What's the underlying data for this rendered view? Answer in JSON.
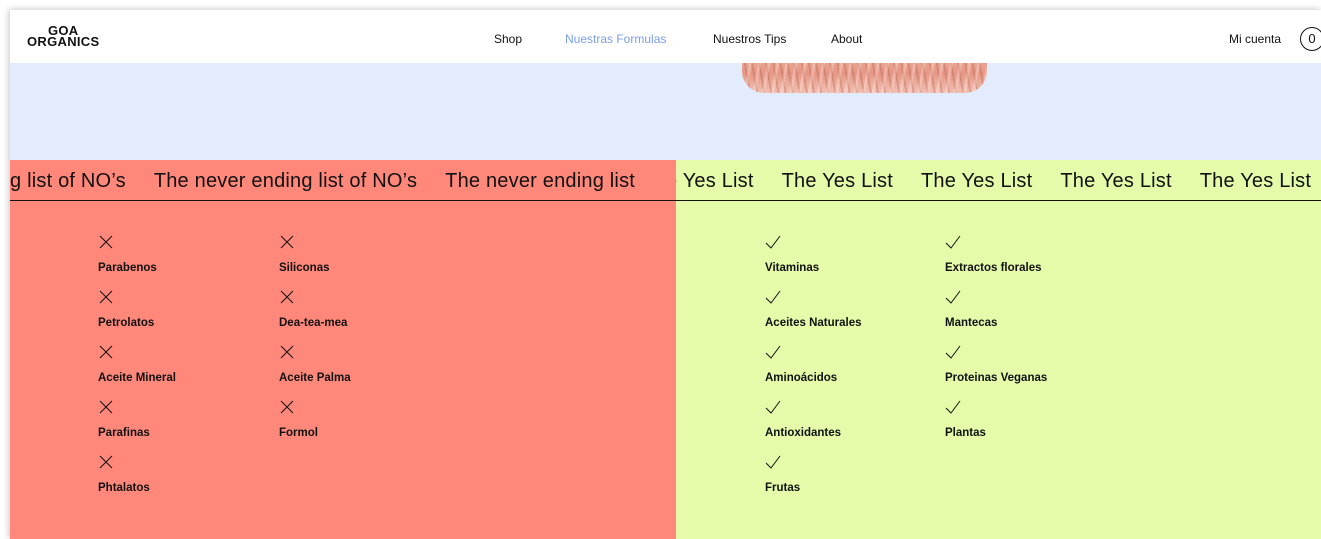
{
  "brand": {
    "logo_line1": "GOA",
    "logo_line2": "ORGANICS"
  },
  "nav": {
    "items": [
      {
        "label": "Shop",
        "active": false
      },
      {
        "label": "Nuestras Formulas",
        "active": true
      },
      {
        "label": "Nuestros Tips",
        "active": false
      },
      {
        "label": "About",
        "active": false
      }
    ]
  },
  "account": {
    "label": "Mi cuenta",
    "cart_count": "0"
  },
  "no_list": {
    "marquee": [
      "g list of NO’s",
      "The never ending list of NO’s",
      "The never ending list"
    ],
    "icon": "x-icon",
    "columns": [
      [
        "Parabenos",
        "Petrolatos",
        "Aceite Mineral",
        "Parafinas",
        "Phtalatos"
      ],
      [
        "Siliconas",
        "Dea-tea-mea",
        "Aceite Palma",
        "Formol"
      ]
    ]
  },
  "yes_list": {
    "marquee": [
      "e Yes List",
      "The Yes List",
      "The Yes List",
      "The Yes List",
      "The Yes List"
    ],
    "icon": "check-icon",
    "columns": [
      [
        "Vitaminas",
        "Aceites Naturales",
        "Aminoácidos",
        "Antioxidantes",
        "Frutas"
      ],
      [
        "Extractos florales",
        "Mantecas",
        "Proteinas Veganas",
        "Plantas"
      ]
    ]
  },
  "colors": {
    "no_bg": "#ff887b",
    "yes_bg": "#e5fbaa",
    "hero_bg": "#e3ecfd",
    "nav_active": "#7c9ee8"
  }
}
